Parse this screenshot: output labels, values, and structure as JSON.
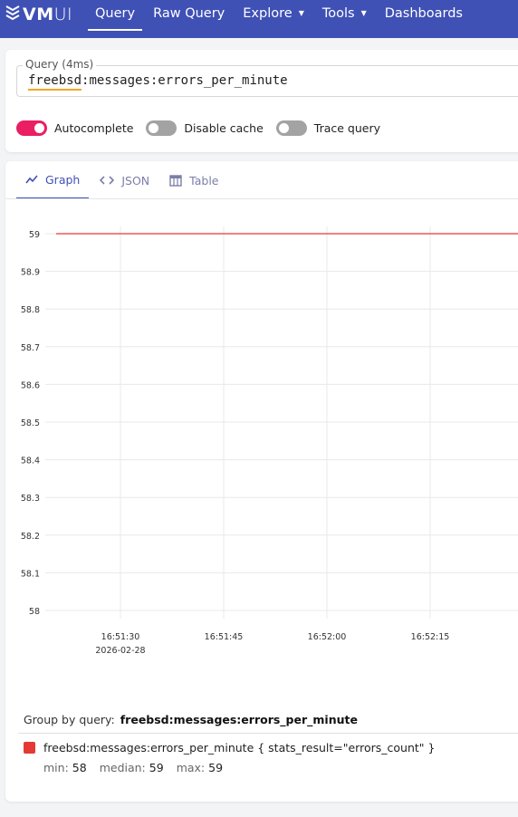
{
  "app": {
    "logo_text_bold": "VM",
    "logo_text_light": "UI"
  },
  "nav": {
    "items": [
      {
        "label": "Query",
        "active": true
      },
      {
        "label": "Raw Query"
      },
      {
        "label": "Explore",
        "caret": "▼"
      },
      {
        "label": "Tools",
        "caret": "▼"
      },
      {
        "label": "Dashboards"
      }
    ]
  },
  "query": {
    "label": "Query (4ms)",
    "metric_part": "freebsd",
    "rest_part": ":messages:errors_per_minute"
  },
  "toggles": [
    {
      "label": "Autocomplete",
      "on": true
    },
    {
      "label": "Disable cache",
      "on": false
    },
    {
      "label": "Trace query",
      "on": false
    }
  ],
  "tabs": [
    {
      "label": "Graph",
      "icon": "line-chart-icon",
      "active": true
    },
    {
      "label": "JSON",
      "icon": "code-icon"
    },
    {
      "label": "Table",
      "icon": "table-icon"
    }
  ],
  "chart_data": {
    "type": "line",
    "y_ticks": [
      "59",
      "58.9",
      "58.8",
      "58.7",
      "58.6",
      "58.5",
      "58.4",
      "58.3",
      "58.2",
      "58.1",
      "58"
    ],
    "ylim": [
      58,
      59
    ],
    "x_ticks": [
      "16:51:30",
      "16:51:45",
      "16:52:00",
      "16:52:15"
    ],
    "x_date_label": "2026-02-28",
    "grid": true,
    "series": [
      {
        "name": "freebsd:messages:errors_per_minute { stats_result=\"errors_count\" }",
        "color": "#e53935",
        "values": [
          59,
          59
        ]
      }
    ]
  },
  "legend": {
    "group_by_label": "Group by query:",
    "group_by_value": "freebsd:messages:errors_per_minute",
    "series_label": "freebsd:messages:errors_per_minute { stats_result=\"errors_count\" }",
    "stats": [
      {
        "label": "min:",
        "value": "58"
      },
      {
        "label": "median:",
        "value": "59"
      },
      {
        "label": "max:",
        "value": "59"
      }
    ]
  }
}
